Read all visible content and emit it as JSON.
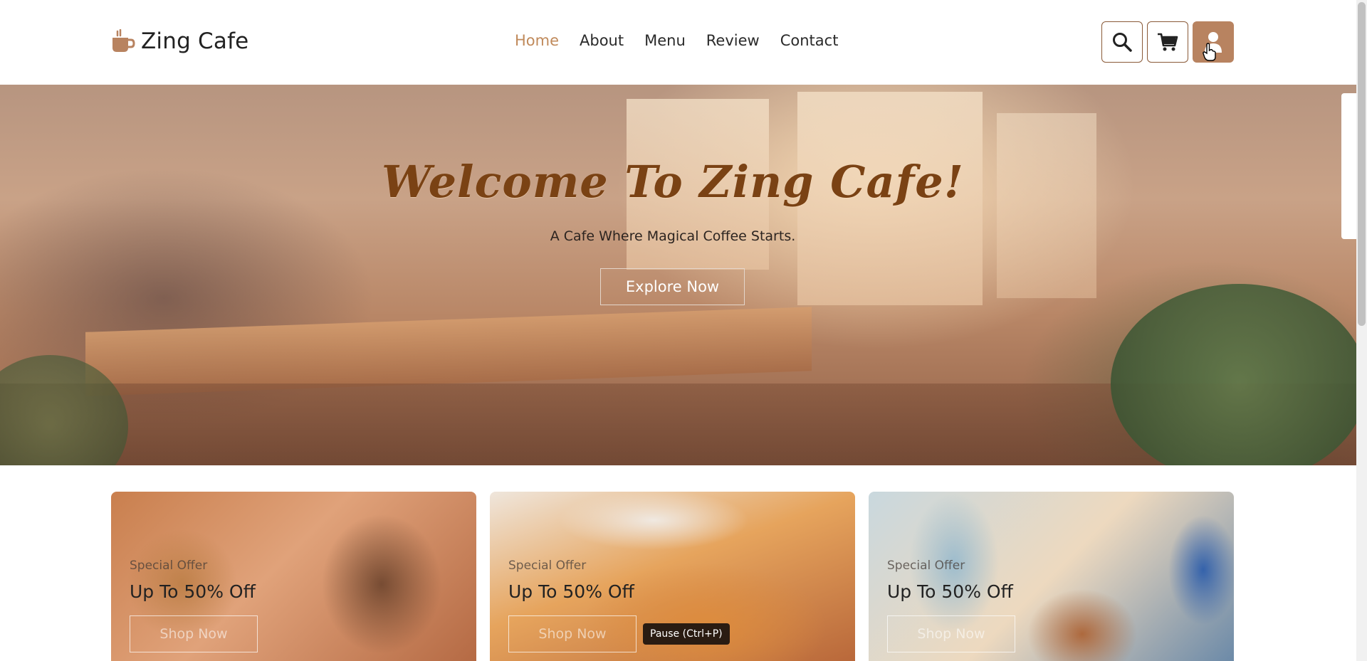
{
  "brand": {
    "name": "Zing Cafe",
    "icon": "coffee-cup-icon"
  },
  "nav": {
    "items": [
      {
        "label": "Home",
        "active": true
      },
      {
        "label": "About",
        "active": false
      },
      {
        "label": "Menu",
        "active": false
      },
      {
        "label": "Review",
        "active": false
      },
      {
        "label": "Contact",
        "active": false
      }
    ]
  },
  "header_actions": [
    {
      "icon": "search-icon"
    },
    {
      "icon": "cart-icon"
    },
    {
      "icon": "user-icon"
    }
  ],
  "hero": {
    "title": "Welcome To Zing Cafe!",
    "subtitle": "A Cafe Where Magical Coffee Starts.",
    "button_label": "Explore Now"
  },
  "offers": [
    {
      "label": "Special Offer",
      "title": "Up To 50% Off",
      "button_label": "Shop Now"
    },
    {
      "label": "Special Offer",
      "title": "Up To 50% Off",
      "button_label": "Shop Now"
    },
    {
      "label": "Special Offer",
      "title": "Up To 50% Off",
      "button_label": "Shop Now"
    }
  ],
  "tooltip": {
    "text": "Pause (Ctrl+P)"
  },
  "colors": {
    "accent": "#c08a5b",
    "hero_title": "#7a4214",
    "active_button": "#b88360"
  }
}
